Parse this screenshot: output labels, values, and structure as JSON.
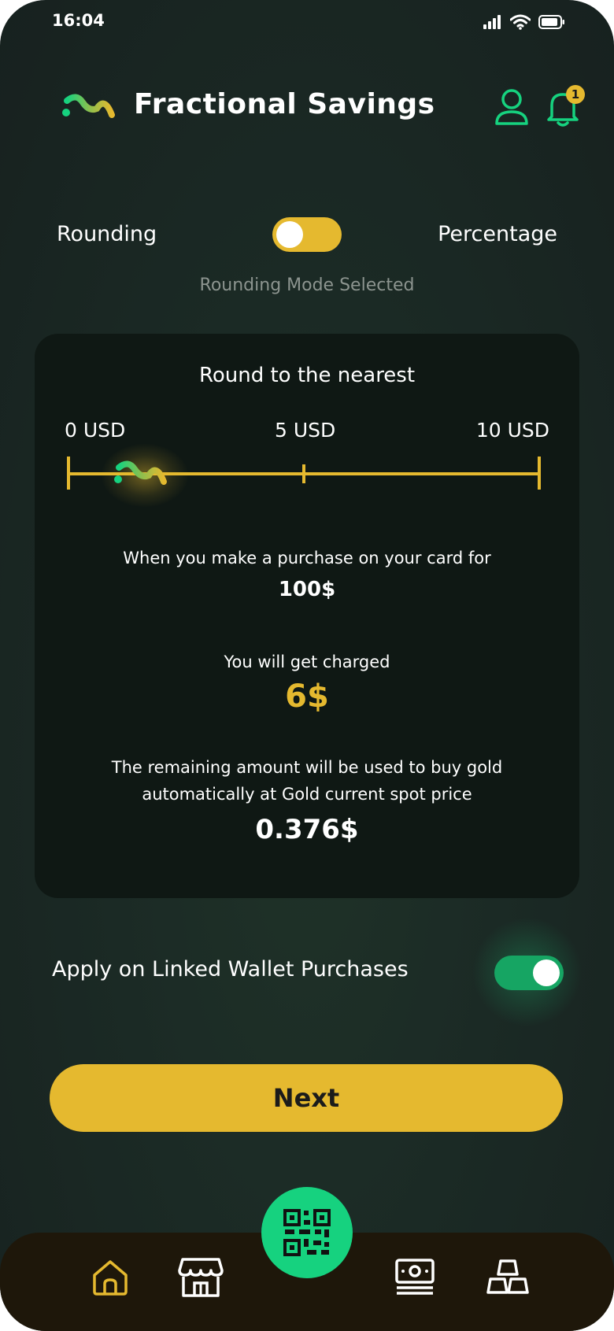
{
  "status_bar": {
    "time": "16:04"
  },
  "header": {
    "title": "Fractional Savings",
    "notification_count": "1"
  },
  "mode": {
    "left_label": "Rounding",
    "right_label": "Percentage",
    "status": "Rounding Mode Selected"
  },
  "card": {
    "title": "Round to the nearest",
    "scale": [
      "0 USD",
      "5 USD",
      "10 USD"
    ],
    "purchase_text": "When you make a purchase on your card for",
    "purchase_amount": "100$",
    "charged_text": "You will get charged",
    "charged_amount": "6$",
    "remaining_line1": "The remaining amount will be used to buy gold",
    "remaining_line2": "automatically at Gold current spot price",
    "remaining_amount": "0.376$"
  },
  "wallet": {
    "label": "Apply on Linked Wallet Purchases"
  },
  "actions": {
    "next_label": "Next"
  },
  "colors": {
    "gold": "#e5b92f",
    "green": "#16d27f",
    "toggle_green": "#16a563",
    "nav_bg": "#1e170a"
  }
}
